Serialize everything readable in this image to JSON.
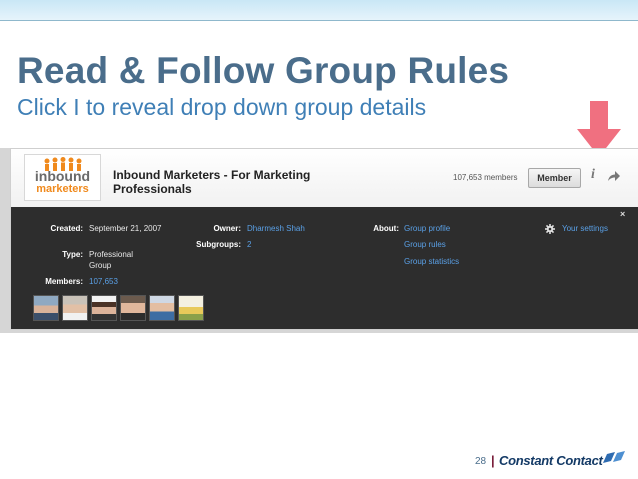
{
  "slide": {
    "title": "Read & Follow Group Rules",
    "subtitle": "Click I to reveal drop down group details",
    "page_number": "28",
    "brand": "Constant Contact",
    "colors": {
      "title": "#4a6d8b",
      "subtitle": "#3f7fb6",
      "arrow": "#f07080"
    }
  },
  "group": {
    "logo_line1": "inbound",
    "logo_line2": "marketers",
    "name": "Inbound Marketers - For Marketing Professionals",
    "members_count": "107,653 members",
    "member_button": "Member",
    "info_icon": "i"
  },
  "details": {
    "created_label": "Created:",
    "created_value": "September 21, 2007",
    "type_label": "Type:",
    "type_value": "Professional Group",
    "members_label": "Members:",
    "members_value": "107,653",
    "owner_label": "Owner:",
    "owner_value": "Dharmesh Shah",
    "subgroups_label": "Subgroups:",
    "subgroups_value": "2",
    "about_label": "About:",
    "about_links": [
      "Group profile",
      "Group rules",
      "Group statistics"
    ],
    "settings_label": "Your settings",
    "close": "×"
  }
}
